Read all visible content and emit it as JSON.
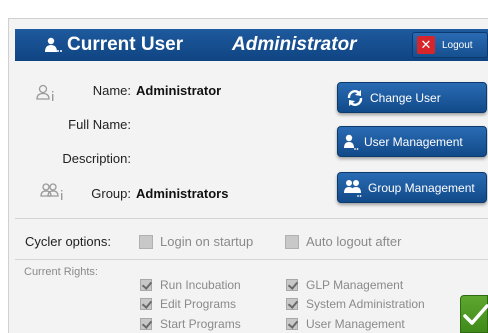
{
  "header": {
    "title": "Current User",
    "user": "Administrator",
    "logout_label": "Logout"
  },
  "user_info": {
    "name_label": "Name:",
    "name_value": "Administrator",
    "full_name_label": "Full Name:",
    "full_name_value": "",
    "description_label": "Description:",
    "description_value": "",
    "group_label": "Group:",
    "group_value": "Administrators"
  },
  "actions": {
    "change_user": "Change User",
    "user_management": "User Management",
    "group_management": "Group Management"
  },
  "cycler": {
    "label": "Cycler options:",
    "login_on_startup": "Login on startup",
    "auto_logout": "Auto logout after"
  },
  "rights": {
    "label": "Current Rights:",
    "items": [
      "Run Incubation",
      "Edit  Programs",
      "Start Programs",
      "GLP Management",
      "System Administration",
      "User Management"
    ]
  },
  "colors": {
    "header_blue": "#1e5a9e",
    "logout_red": "#d6262b",
    "ok_green": "#4f9a25"
  }
}
